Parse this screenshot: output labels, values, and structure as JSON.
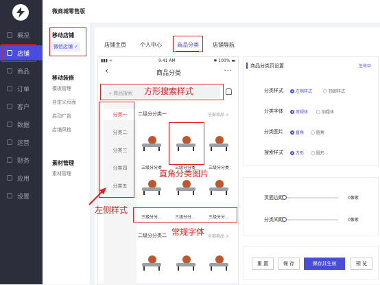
{
  "app": {
    "title": "微商城零售版"
  },
  "nav": {
    "items": [
      {
        "label": "概况",
        "icon": "overview-icon"
      },
      {
        "label": "店铺",
        "icon": "store-icon",
        "active": true
      },
      {
        "label": "商品",
        "icon": "goods-icon"
      },
      {
        "label": "订单",
        "icon": "order-icon"
      },
      {
        "label": "客户",
        "icon": "customer-icon"
      },
      {
        "label": "数据",
        "icon": "data-icon"
      },
      {
        "label": "运营",
        "icon": "operation-icon"
      },
      {
        "label": "财务",
        "icon": "finance-icon"
      },
      {
        "label": "应用",
        "icon": "apps-icon"
      },
      {
        "label": "设置",
        "icon": "settings-icon"
      }
    ]
  },
  "subnav": {
    "group1": {
      "title": "移动店铺",
      "items": [
        "微信店铺 ✓"
      ]
    },
    "group2": {
      "title": "移动装修",
      "items": [
        "模板管理",
        "自定义页面",
        "启动广告",
        "店铺风格"
      ]
    },
    "group3": {
      "title": "素材管理",
      "items": [
        "素材管理"
      ]
    }
  },
  "tabs": [
    "店铺主页",
    "个人中心",
    "商品分类",
    "店铺导航"
  ],
  "phone": {
    "time": "9:41 AM",
    "battery": "100%",
    "title": "商品分类",
    "more": "...",
    "search_placeholder": "商品搜索",
    "categories": [
      "分类一",
      "分类二",
      "分类三",
      "分类四",
      "分类五"
    ],
    "section1": {
      "title": "二级分分类一",
      "all": "全部商品 >"
    },
    "section2": {
      "title": "二级分分类二",
      "all": "全部商品 >"
    },
    "item_label": "三级分分类",
    "item_label_short": "三级分分...",
    "font_row": [
      "三级分分...",
      "三级分分...",
      "三级分分..."
    ]
  },
  "settings": {
    "title": "商品分类页设置",
    "status": "生效中",
    "rows": [
      {
        "label": "分类样式",
        "options": [
          "左侧样式",
          "顶部样式"
        ],
        "selected": 0
      },
      {
        "label": "分类字体",
        "options": [
          "常规体",
          "加粗体"
        ],
        "selected": 0
      },
      {
        "label": "分类图片",
        "options": [
          "直角",
          "圆角"
        ],
        "selected": 0
      },
      {
        "label": "搜索样式",
        "options": [
          "方形",
          "圆形"
        ],
        "selected": 0
      }
    ],
    "page_margin": {
      "label": "页面边距",
      "value": "0像素",
      "level": 0
    },
    "cat_spacing": {
      "label": "分类间距",
      "value": "0像素",
      "level": 0
    },
    "buttons": [
      "重 置",
      "保 存",
      "保存并生效",
      "预 览"
    ]
  },
  "annotations": {
    "search": "方形搜索样式",
    "left": "左侧样式",
    "image": "直角分类图片",
    "font": "常规字体"
  },
  "colors": {
    "accent": "#4a4cdc",
    "annotation": "#e02020",
    "nav_bg": "#2c2e3b"
  }
}
